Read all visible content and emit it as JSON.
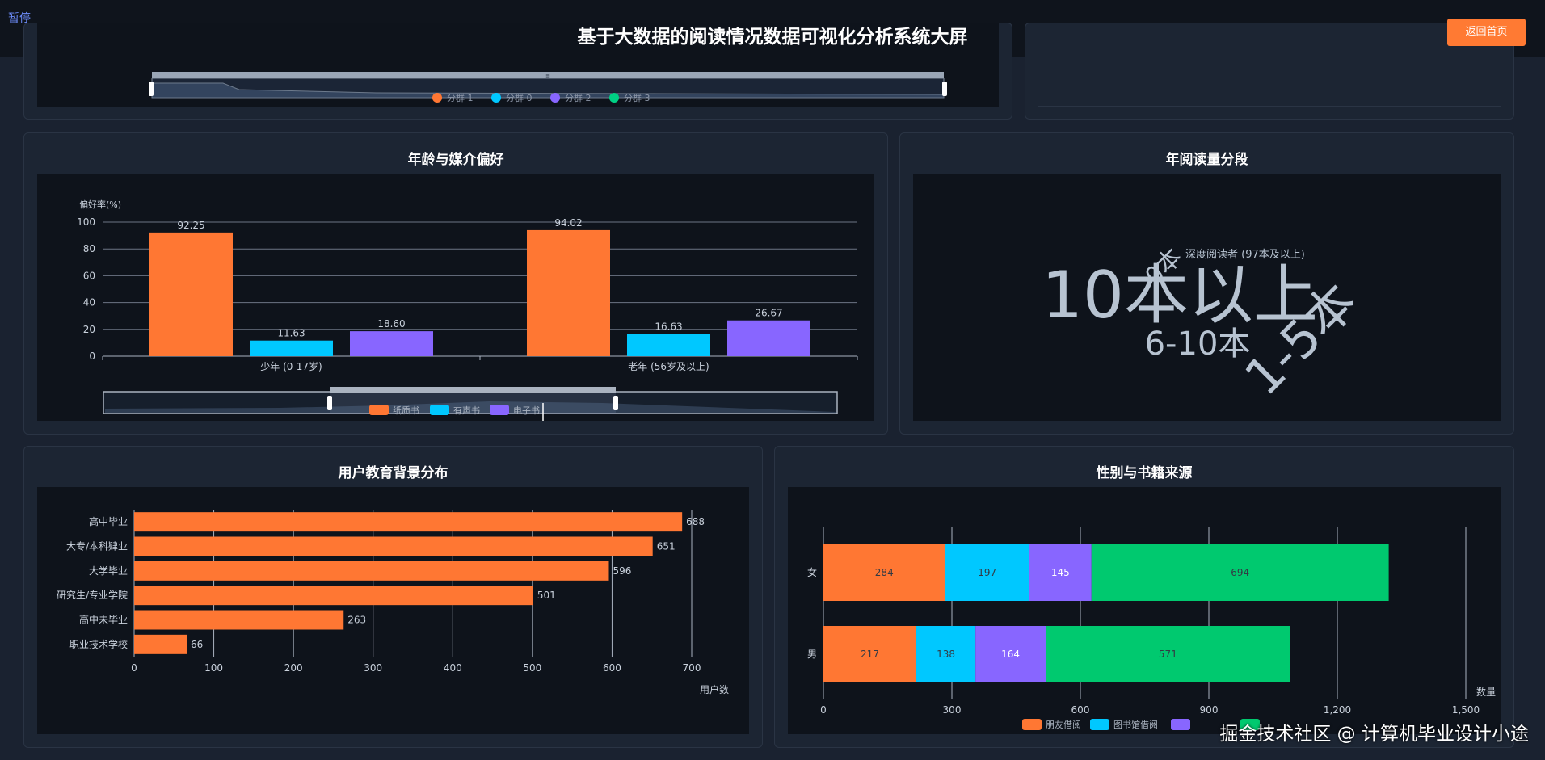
{
  "header": {
    "pause_label": "暂停",
    "title": "基于大数据的阅读情况数据可视化分析系统大屏",
    "back_button": "返回首页"
  },
  "top_panel": {
    "legend": [
      "分群 1",
      "分群 0",
      "分群 2",
      "分群 3"
    ],
    "legend_colors": [
      "#ff7733",
      "#00c8ff",
      "#8866ff",
      "#00d084"
    ],
    "zoom_label": "≡"
  },
  "charts": {
    "age_media": {
      "title": "年龄与媒介偏好",
      "ylabel": "偏好率(%)",
      "legend": [
        "纸质书",
        "有声书",
        "电子书"
      ]
    },
    "volume": {
      "title": "年阅读量分段"
    },
    "education": {
      "title": "用户教育背景分布",
      "xlabel": "用户数"
    },
    "gender_source": {
      "title": "性别与书籍来源",
      "xlabel": "数量",
      "legend": [
        "朋友借阅",
        "图书馆借阅",
        "",
        ""
      ]
    }
  },
  "chart_data": [
    {
      "type": "bar",
      "title": "年龄与媒介偏好",
      "categories": [
        "少年 (0-17岁)",
        "老年 (56岁及以上)"
      ],
      "series": [
        {
          "name": "纸质书",
          "values": [
            92.25,
            94.02
          ],
          "color": "#ff7733"
        },
        {
          "name": "有声书",
          "values": [
            11.63,
            16.63
          ],
          "color": "#00c8ff"
        },
        {
          "name": "电子书",
          "values": [
            18.6,
            26.67
          ],
          "color": "#8866ff"
        }
      ],
      "ylabel": "偏好率(%)",
      "ylim": [
        0,
        100
      ],
      "yticks": [
        0,
        20,
        40,
        60,
        80,
        100
      ],
      "grid": true,
      "legend_position": "bottom"
    },
    {
      "type": "wordcloud",
      "title": "年阅读量分段",
      "words": [
        {
          "text": "10本以上",
          "weight": 1.0
        },
        {
          "text": "1-5本",
          "weight": 0.82
        },
        {
          "text": "6-10本",
          "weight": 0.55
        },
        {
          "text": "0本",
          "weight": 0.4
        }
      ],
      "tooltip": "深度阅读者 (97本及以上)"
    },
    {
      "type": "bar",
      "orientation": "horizontal",
      "title": "用户教育背景分布",
      "categories": [
        "高中毕业",
        "大专/本科肄业",
        "大学毕业",
        "研究生/专业学院",
        "高中未毕业",
        "职业技术学校"
      ],
      "values": [
        688,
        651,
        596,
        501,
        263,
        66
      ],
      "xlabel": "用户数",
      "xlim": [
        0,
        700
      ],
      "xticks": [
        0,
        100,
        200,
        300,
        400,
        500,
        600,
        700
      ],
      "grid": true,
      "color": "#ff7733"
    },
    {
      "type": "bar",
      "orientation": "horizontal",
      "stacked": true,
      "title": "性别与书籍来源",
      "categories": [
        "女",
        "男"
      ],
      "series": [
        {
          "name": "朋友借阅",
          "values": [
            284,
            217
          ],
          "color": "#ff7733"
        },
        {
          "name": "图书馆借阅",
          "values": [
            197,
            138
          ],
          "color": "#00c8ff"
        },
        {
          "values": [
            145,
            164
          ],
          "color": "#8866ff"
        },
        {
          "values": [
            694,
            571
          ],
          "color": "#00c96f"
        }
      ],
      "xlabel": "数量",
      "xlim": [
        0,
        1500
      ],
      "xticks": [
        0,
        300,
        600,
        900,
        1200,
        1500
      ],
      "tick_labels": [
        "0",
        "300",
        "600",
        "900",
        "1,200",
        "1,500"
      ],
      "grid": true,
      "legend_position": "bottom"
    }
  ],
  "footer": {
    "watermark": "掘金技术社区 @ 计算机毕业设计小途"
  }
}
